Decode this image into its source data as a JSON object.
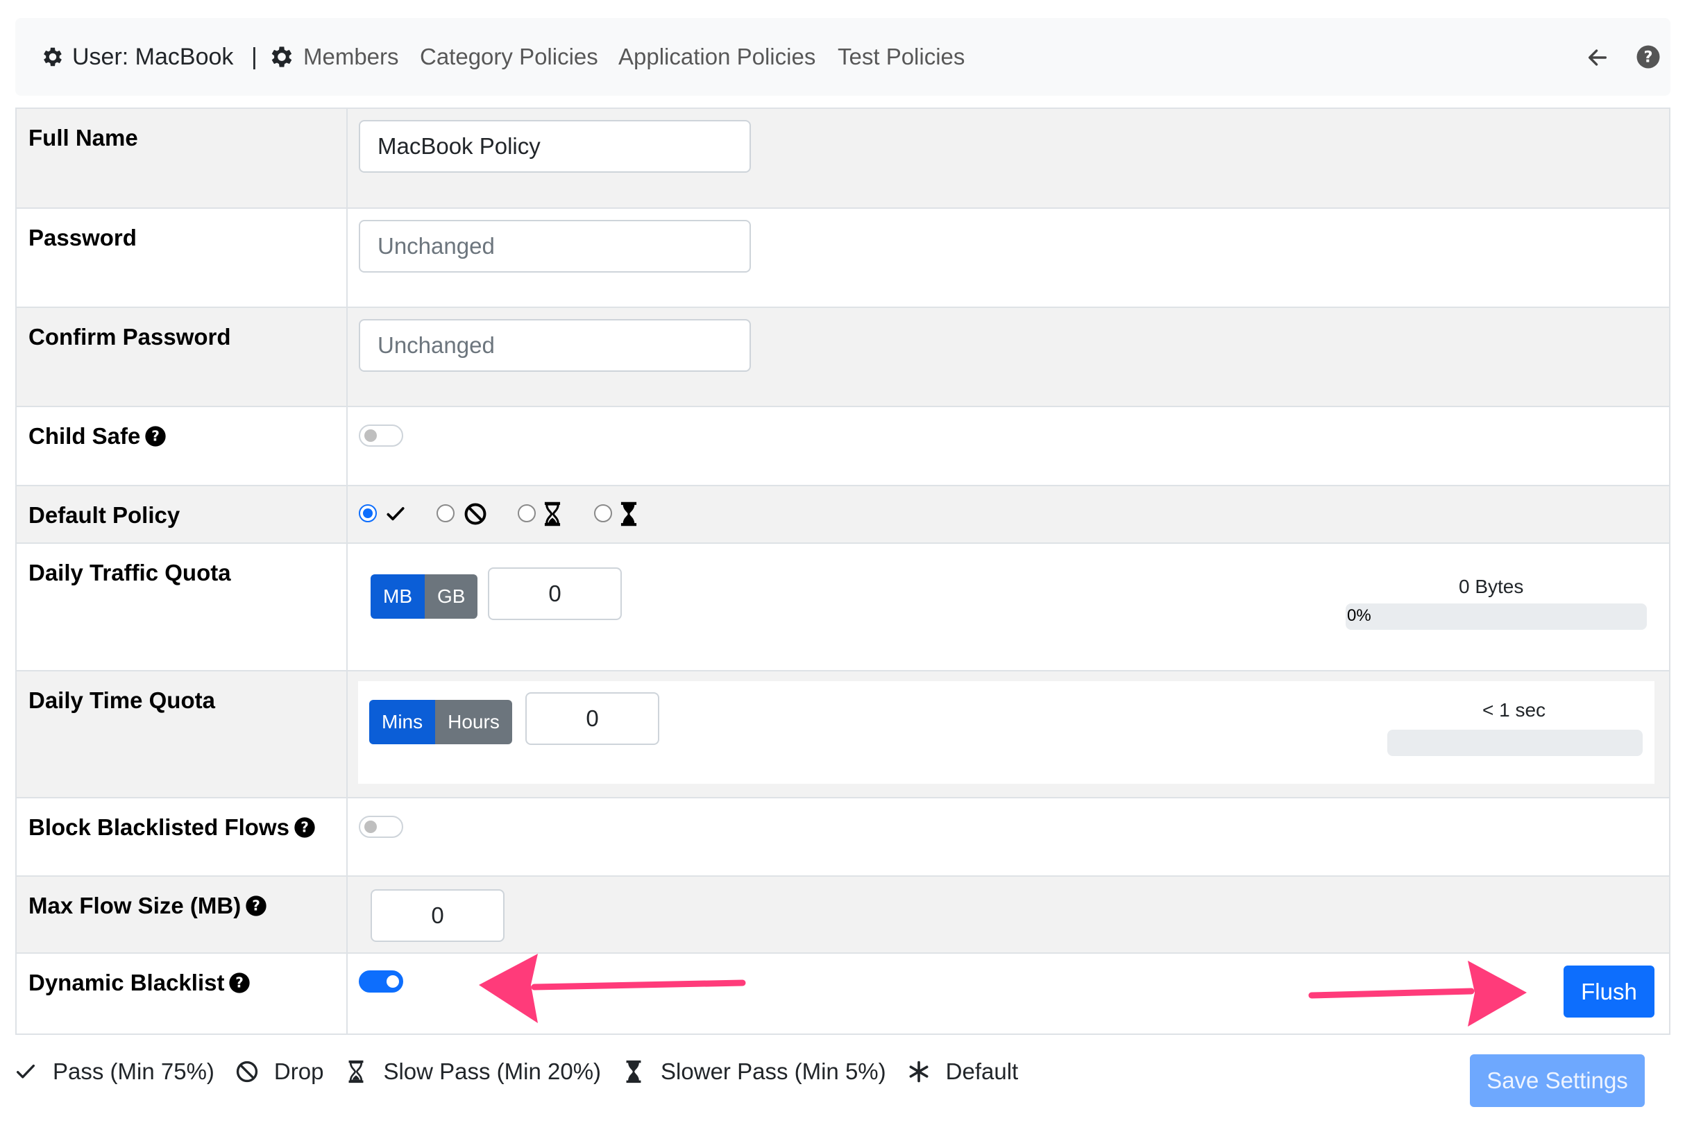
{
  "navbar": {
    "brand": "User: MacBook",
    "separator": "|",
    "links": [
      "Members",
      "Category Policies",
      "Application Policies",
      "Test Policies"
    ]
  },
  "form": {
    "full_name": {
      "label": "Full Name",
      "value": "MacBook Policy"
    },
    "password": {
      "label": "Password",
      "placeholder": "Unchanged"
    },
    "confirm_password": {
      "label": "Confirm Password",
      "placeholder": "Unchanged"
    },
    "child_safe": {
      "label": "Child Safe",
      "enabled": false
    },
    "default_policy": {
      "label": "Default Policy",
      "selected": "pass",
      "options": [
        "pass",
        "drop",
        "slow-pass",
        "slower-pass"
      ]
    },
    "daily_traffic_quota": {
      "label": "Daily Traffic Quota",
      "units": [
        "MB",
        "GB"
      ],
      "selected_unit": "MB",
      "value": "0",
      "usage_text": "0 Bytes",
      "progress_label": "0%",
      "progress_percent": 0
    },
    "daily_time_quota": {
      "label": "Daily Time Quota",
      "units": [
        "Mins",
        "Hours"
      ],
      "selected_unit": "Mins",
      "value": "0",
      "usage_text": "< 1 sec",
      "progress_percent": 0
    },
    "block_blacklisted_flows": {
      "label": "Block Blacklisted Flows",
      "enabled": false
    },
    "max_flow_size": {
      "label": "Max Flow Size (MB)",
      "value": "0"
    },
    "dynamic_blacklist": {
      "label": "Dynamic Blacklist",
      "enabled": true,
      "flush_label": "Flush"
    }
  },
  "legend": [
    {
      "icon": "check-icon",
      "text": "Pass (Min 75%)"
    },
    {
      "icon": "ban-icon",
      "text": "Drop"
    },
    {
      "icon": "hourglass-half-icon",
      "text": "Slow Pass (Min 20%)"
    },
    {
      "icon": "hourglass-full-icon",
      "text": "Slower Pass (Min 5%)"
    },
    {
      "icon": "asterisk-icon",
      "text": "Default"
    }
  ],
  "save_button": "Save Settings",
  "colors": {
    "primary": "#0d6efd",
    "primary_dark": "#0b5ed7",
    "secondary": "#6c757d",
    "annotation_arrow": "#ff3b7a"
  }
}
